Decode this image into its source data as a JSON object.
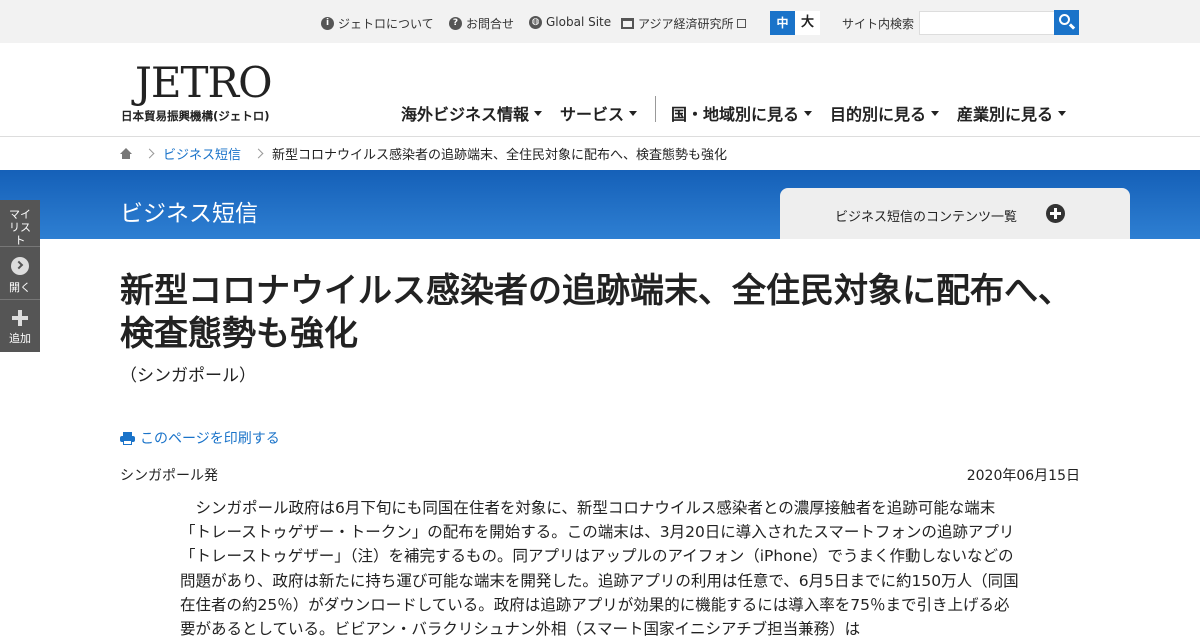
{
  "utility_bar": {
    "links": [
      {
        "label": "ジェトロについて",
        "icon": "info-icon"
      },
      {
        "label": "お問合せ",
        "icon": "question-icon"
      },
      {
        "label": "Global Site",
        "icon": "globe-icon"
      },
      {
        "label": "アジア経済研究所",
        "icon": "building-icon"
      }
    ],
    "font_size": {
      "medium": "中",
      "large": "大"
    },
    "search_label": "サイト内検索",
    "search_placeholder": ""
  },
  "header": {
    "logo_text": "JETRO",
    "logo_subtitle": "日本貿易振興機構(ジェトロ)",
    "nav": [
      "海外ビジネス情報",
      "サービス",
      "国・地域別に見る",
      "目的別に見る",
      "産業別に見る"
    ]
  },
  "breadcrumb": {
    "section": "ビジネス短信",
    "current": "新型コロナウイルス感染者の追跡端末、全住民対象に配布へ、検査態勢も強化"
  },
  "band": {
    "title": "ビジネス短信",
    "contents_tab": "ビジネス短信のコンテンツ一覧"
  },
  "sidebar": {
    "mylist": "マイリスト",
    "open": "開く",
    "add": "追加"
  },
  "article": {
    "title": "新型コロナウイルス感染者の追跡端末、全住民対象に配布へ、検査態勢も強化",
    "country": "（シンガポール）",
    "print_label": "このページを印刷する",
    "origin": "シンガポール発",
    "date": "2020年06月15日",
    "body": "シンガポール政府は6月下旬にも同国在住者を対象に、新型コロナウイルス感染者との濃厚接触者を追跡可能な端末「トレーストゥゲザー・トークン」の配布を開始する。この端末は、3月20日に導入されたスマートフォンの追跡アプリ「トレーストゥゲザー」（注）を補完するもの。同アプリはアップルのアイフォン（iPhone）でうまく作動しないなどの問題があり、政府は新たに持ち運び可能な端末を開発した。追跡アプリの利用は任意で、6月5日までに約150万人（同国在住者の約25％）がダウンロードしている。政府は追跡アプリが効果的に機能するには導入率を75％まで引き上げる必要があるとしている。ビビアン・バラクリシュナン外相（スマート国家イニシアチブ担当兼務）は"
  },
  "colors": {
    "accent": "#1a73c9",
    "band": "#1560b8",
    "sidebar": "#555555"
  }
}
